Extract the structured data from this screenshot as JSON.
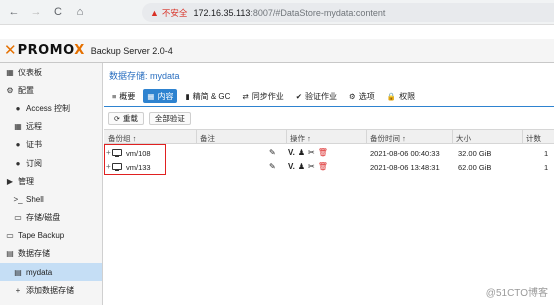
{
  "browser": {
    "back": "←",
    "forward": "→",
    "reload": "C",
    "home": "⌂",
    "warning_text": "不安全",
    "url_host": "172.16.35.113",
    "url_rest": ":8007/#DataStore-mydata:content"
  },
  "header": {
    "logo_left": "PRO",
    "logo_right": "MO",
    "product": "Backup Server 2.0-4"
  },
  "sidebar": {
    "items": [
      {
        "label": "仪表板",
        "icon": "▦"
      },
      {
        "label": "配置",
        "icon": "⚙"
      },
      {
        "label": "Access 控制",
        "icon": "●"
      },
      {
        "label": "远程",
        "icon": "▦"
      },
      {
        "label": "证书",
        "icon": "●"
      },
      {
        "label": "订阅",
        "icon": "●"
      },
      {
        "label": "管理",
        "icon": "▶"
      },
      {
        "label": "Shell",
        "icon": ">_"
      },
      {
        "label": "存储/磁盘",
        "icon": "▭"
      },
      {
        "label": "Tape Backup",
        "icon": "▭"
      },
      {
        "label": "数据存储",
        "icon": "▤"
      },
      {
        "label": "mydata",
        "icon": "▤"
      },
      {
        "label": "添加数据存储",
        "icon": "+"
      }
    ]
  },
  "main": {
    "title": "数据存储: mydata",
    "tabs": [
      {
        "label": "概要",
        "icon": "≡"
      },
      {
        "label": "内容",
        "icon": "▦"
      },
      {
        "label": "精简 & GC",
        "icon": "▮"
      },
      {
        "label": "同步作业",
        "icon": "⇄"
      },
      {
        "label": "验证作业",
        "icon": "✔"
      },
      {
        "label": "选项",
        "icon": "⚙"
      },
      {
        "label": "权限",
        "icon": "🔒"
      }
    ],
    "toolbar": {
      "reload": "重载",
      "add_verify": "全部验证"
    },
    "columns": [
      "备份组 ↑",
      "备注",
      "操作 ↑",
      "备份时间 ↑",
      "大小",
      "计数"
    ],
    "rows": [
      {
        "group": "vm/108",
        "note": "",
        "time": "2021-08-06 00:40:33",
        "size": "32.00 GiB",
        "count": "1"
      },
      {
        "group": "vm/133",
        "note": "",
        "time": "2021-08-06 13:48:31",
        "size": "62.00 GiB",
        "count": "1"
      }
    ],
    "actions": {
      "verify": "V.",
      "owner": "♟",
      "prune": "✂",
      "delete": "🗑",
      "edit": "✎"
    }
  },
  "watermark": "@51CTO博客",
  "colors": {
    "accent": "#2e83d0",
    "brand": "#e57000",
    "highlight": "#e02020"
  }
}
